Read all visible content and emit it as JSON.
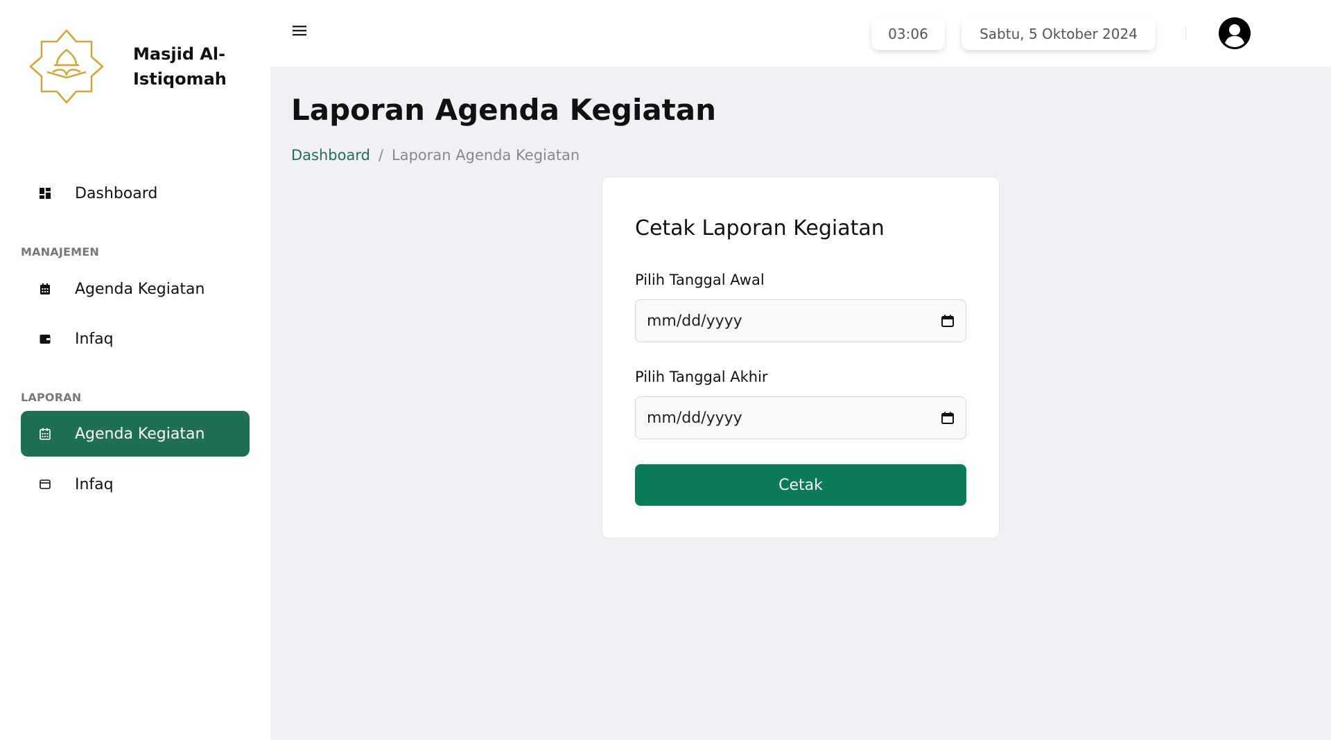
{
  "brand": {
    "name": "Masjid Al-Istiqomah"
  },
  "sidebar": {
    "dashboard": {
      "label": "Dashboard",
      "icon": "dashboard-icon"
    },
    "section_manajemen": "MANAJEMEN",
    "manajemen_items": [
      {
        "label": "Agenda Kegiatan",
        "icon": "calendar-icon"
      },
      {
        "label": "Infaq",
        "icon": "wallet-icon"
      }
    ],
    "section_laporan": "LAPORAN",
    "laporan_items": [
      {
        "label": "Agenda Kegiatan",
        "icon": "calendar-icon",
        "active": true
      },
      {
        "label": "Infaq",
        "icon": "wallet-outline-icon"
      }
    ],
    "accent_color": "#1f6f55"
  },
  "topbar": {
    "time": "03:06",
    "date": "Sabtu, 5 Oktober 2024"
  },
  "main": {
    "title": "Laporan Agenda Kegiatan",
    "breadcrumb": {
      "link": "Dashboard",
      "separator": "/",
      "current": "Laporan Agenda Kegiatan"
    },
    "card": {
      "title": "Cetak Laporan Kegiatan",
      "start_label": "Pilih Tanggal Awal",
      "start_value": "mm/dd/yyyy",
      "end_label": "Pilih Tanggal Akhir",
      "end_value": "mm/dd/yyyy",
      "button_label": "Cetak",
      "button_color": "#0b7a58"
    }
  }
}
